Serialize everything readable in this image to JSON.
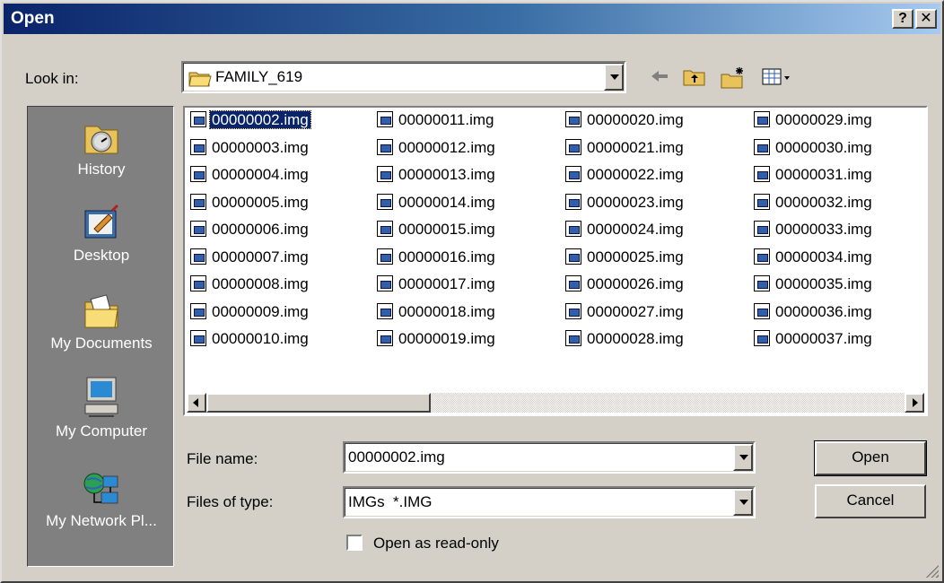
{
  "window": {
    "title": "Open",
    "help_label": "?",
    "close_label": "✕"
  },
  "look_in": {
    "label": "Look in:",
    "value": "FAMILY_619"
  },
  "places": [
    {
      "label": "History",
      "icon": "history-icon"
    },
    {
      "label": "Desktop",
      "icon": "desktop-icon"
    },
    {
      "label": "My Documents",
      "icon": "my-documents-icon"
    },
    {
      "label": "My Computer",
      "icon": "my-computer-icon"
    },
    {
      "label": "My Network Pl...",
      "icon": "my-network-places-icon"
    }
  ],
  "files": {
    "columns": [
      [
        "00000002.img",
        "00000003.img",
        "00000004.img",
        "00000005.img",
        "00000006.img",
        "00000007.img",
        "00000008.img",
        "00000009.img",
        "00000010.img"
      ],
      [
        "00000011.img",
        "00000012.img",
        "00000013.img",
        "00000014.img",
        "00000015.img",
        "00000016.img",
        "00000017.img",
        "00000018.img",
        "00000019.img"
      ],
      [
        "00000020.img",
        "00000021.img",
        "00000022.img",
        "00000023.img",
        "00000024.img",
        "00000025.img",
        "00000026.img",
        "00000027.img",
        "00000028.img"
      ],
      [
        "00000029.img",
        "00000030.img",
        "00000031.img",
        "00000032.img",
        "00000033.img",
        "00000034.img",
        "00000035.img",
        "00000036.img",
        "00000037.img"
      ]
    ],
    "selected": "00000002.img"
  },
  "file_name": {
    "label": "File name:",
    "value": "00000002.img"
  },
  "file_type": {
    "label": "Files of type:",
    "value": "IMGs  *.IMG"
  },
  "read_only": {
    "label": "Open as read-only",
    "checked": false
  },
  "buttons": {
    "open": "Open",
    "cancel": "Cancel"
  },
  "colors": {
    "title_start": "#0a246a",
    "title_end": "#a6caf0",
    "face": "#d4d0c8",
    "places_bg": "#808080"
  }
}
